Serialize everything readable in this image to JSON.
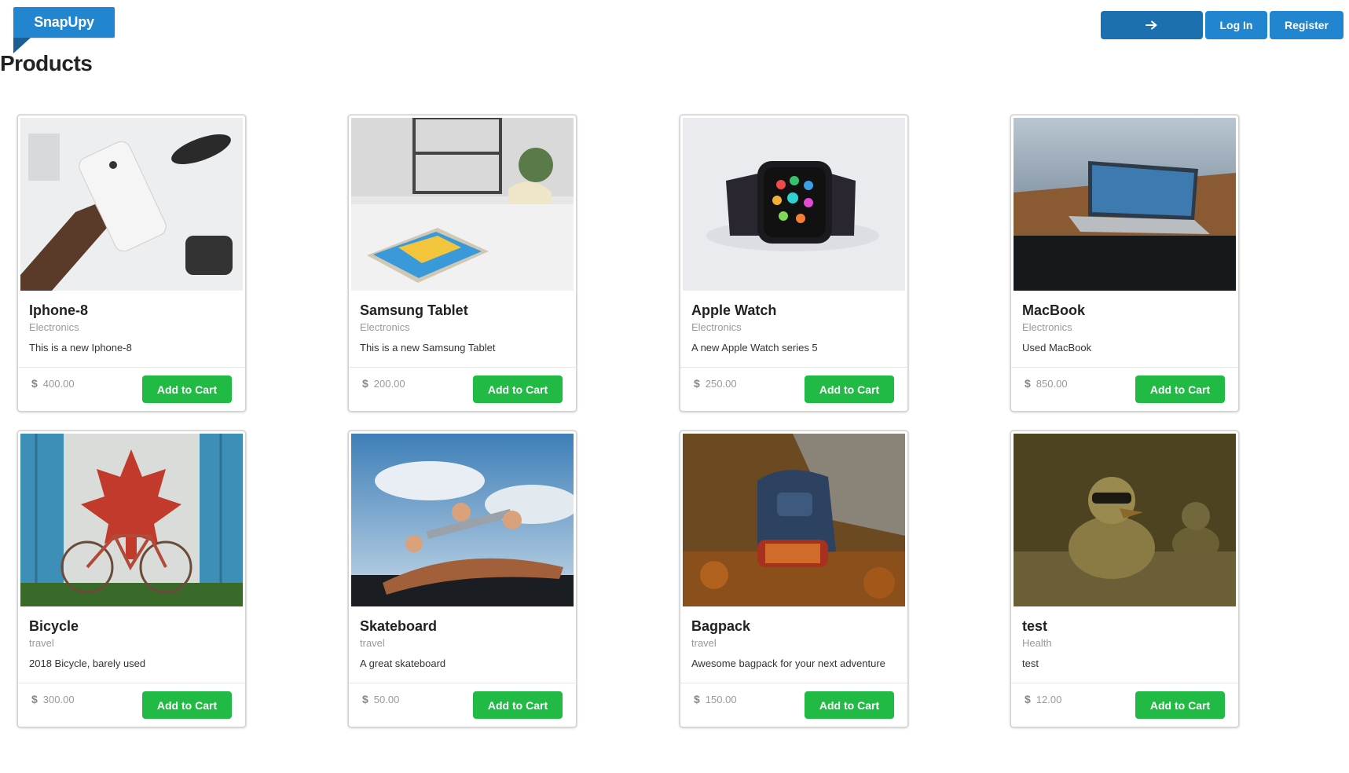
{
  "brand": {
    "name": "SnapUpy"
  },
  "header": {
    "title": "Products"
  },
  "nav": {
    "login": "Log In",
    "register": "Register"
  },
  "products": [
    {
      "name": "Iphone-8",
      "category": "Electronics",
      "description": "This is a new Iphone-8",
      "price": "400.00",
      "button": "Add to Cart"
    },
    {
      "name": "Samsung Tablet",
      "category": "Electronics",
      "description": "This is a new Samsung Tablet",
      "price": "200.00",
      "button": "Add to Cart"
    },
    {
      "name": "Apple Watch",
      "category": "Electronics",
      "description": "A new Apple Watch series 5",
      "price": "250.00",
      "button": "Add to Cart"
    },
    {
      "name": "MacBook",
      "category": "Electronics",
      "description": "Used MacBook",
      "price": "850.00",
      "button": "Add to Cart"
    },
    {
      "name": "Bicycle",
      "category": "travel",
      "description": "2018 Bicycle, barely used",
      "price": "300.00",
      "button": "Add to Cart"
    },
    {
      "name": "Skateboard",
      "category": "travel",
      "description": "A great skateboard",
      "price": "50.00",
      "button": "Add to Cart"
    },
    {
      "name": "Bagpack",
      "category": "travel",
      "description": "Awesome bagpack for your next adventure",
      "price": "150.00",
      "button": "Add to Cart"
    },
    {
      "name": "test",
      "category": "Health",
      "description": "test",
      "price": "12.00",
      "button": "Add to Cart"
    }
  ],
  "colors": {
    "primary": "#2185d0",
    "success": "#21ba45"
  },
  "icons": {
    "nav_arrow": "arrow-right-icon",
    "currency": "dollar-icon"
  }
}
